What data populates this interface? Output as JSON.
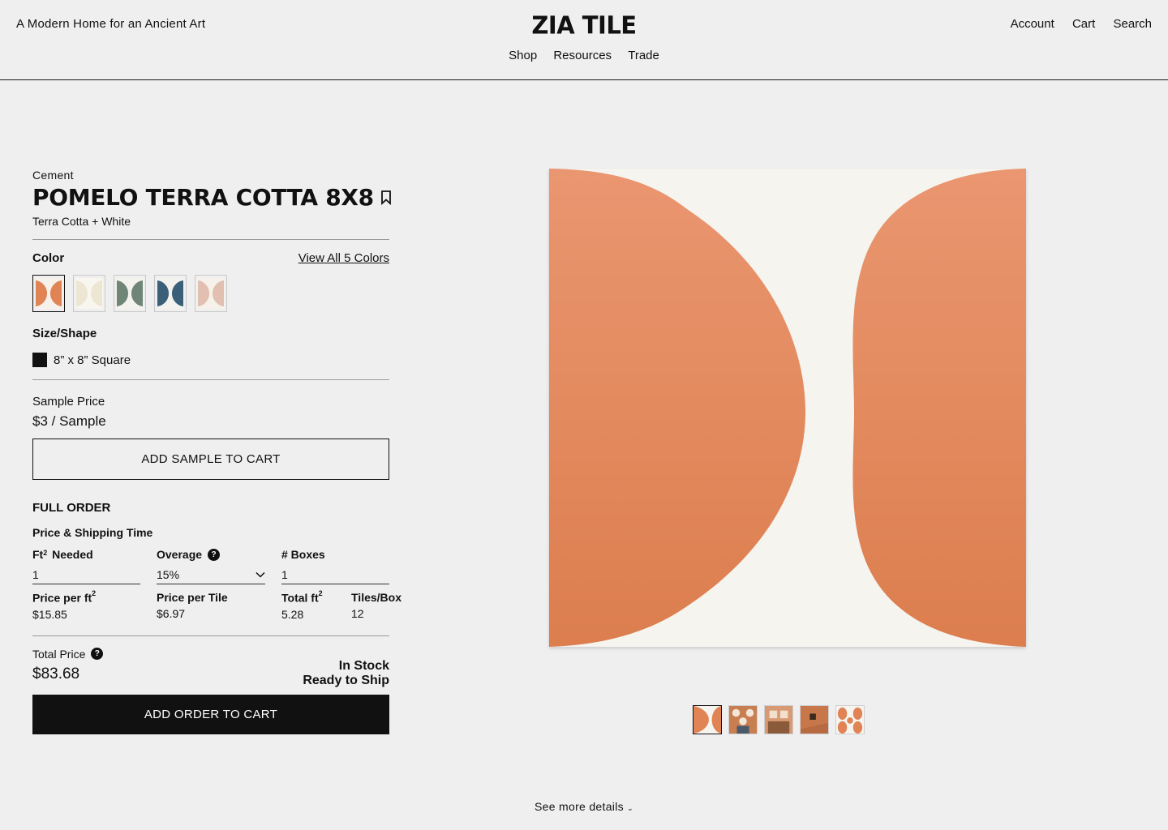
{
  "header": {
    "tagline": "A Modern Home for an Ancient Art",
    "logo": "ZIA TILE",
    "nav": [
      "Shop",
      "Resources",
      "Trade"
    ],
    "util": [
      "Account",
      "Cart",
      "Search"
    ]
  },
  "product": {
    "category": "Cement",
    "title": "POMELO TERRA COTTA 8X8",
    "subtitle": "Terra Cotta + White",
    "color_label": "Color",
    "view_all": "View All 5 Colors",
    "swatch_colors": [
      {
        "fg": "#e08355",
        "bg": "#f6f1ea"
      },
      {
        "fg": "#ece6d2",
        "bg": "#f8f6ef"
      },
      {
        "fg": "#6f8577",
        "bg": "#f4f2ec"
      },
      {
        "fg": "#3a6079",
        "bg": "#f4f2ec"
      },
      {
        "fg": "#e1bfb1",
        "bg": "#f6f1ea"
      }
    ],
    "size_label": "Size/Shape",
    "size_option": "8” x 8” Square",
    "sample_label": "Sample Price",
    "sample_price": "$3 / Sample",
    "add_sample": "ADD SAMPLE TO CART",
    "full_order": "FULL ORDER",
    "ship_label": "Price & Shipping Time",
    "fields": {
      "ft_needed_label": "Needed",
      "ft_needed_prefix": "Ft",
      "ft_needed_value": "1",
      "overage_label": "Overage",
      "overage_value": "15%",
      "boxes_label": "# Boxes",
      "boxes_value": "1"
    },
    "info": {
      "price_ft_label": "Price per ft",
      "price_ft": "$15.85",
      "price_tile_label": "Price per Tile",
      "price_tile": "$6.97",
      "total_ft_label": "Total ft",
      "total_ft": "5.28",
      "tiles_box_label": "Tiles/Box",
      "tiles_box": "12"
    },
    "total_label": "Total Price",
    "total_price": "$83.68",
    "stock_1": "In Stock",
    "stock_2": "Ready to Ship",
    "add_order": "ADD ORDER TO CART"
  },
  "colors": {
    "terra_cotta": "#e08355",
    "white": "#f6f4ef",
    "dark": "#111111"
  },
  "footer": {
    "more": "See more details"
  }
}
